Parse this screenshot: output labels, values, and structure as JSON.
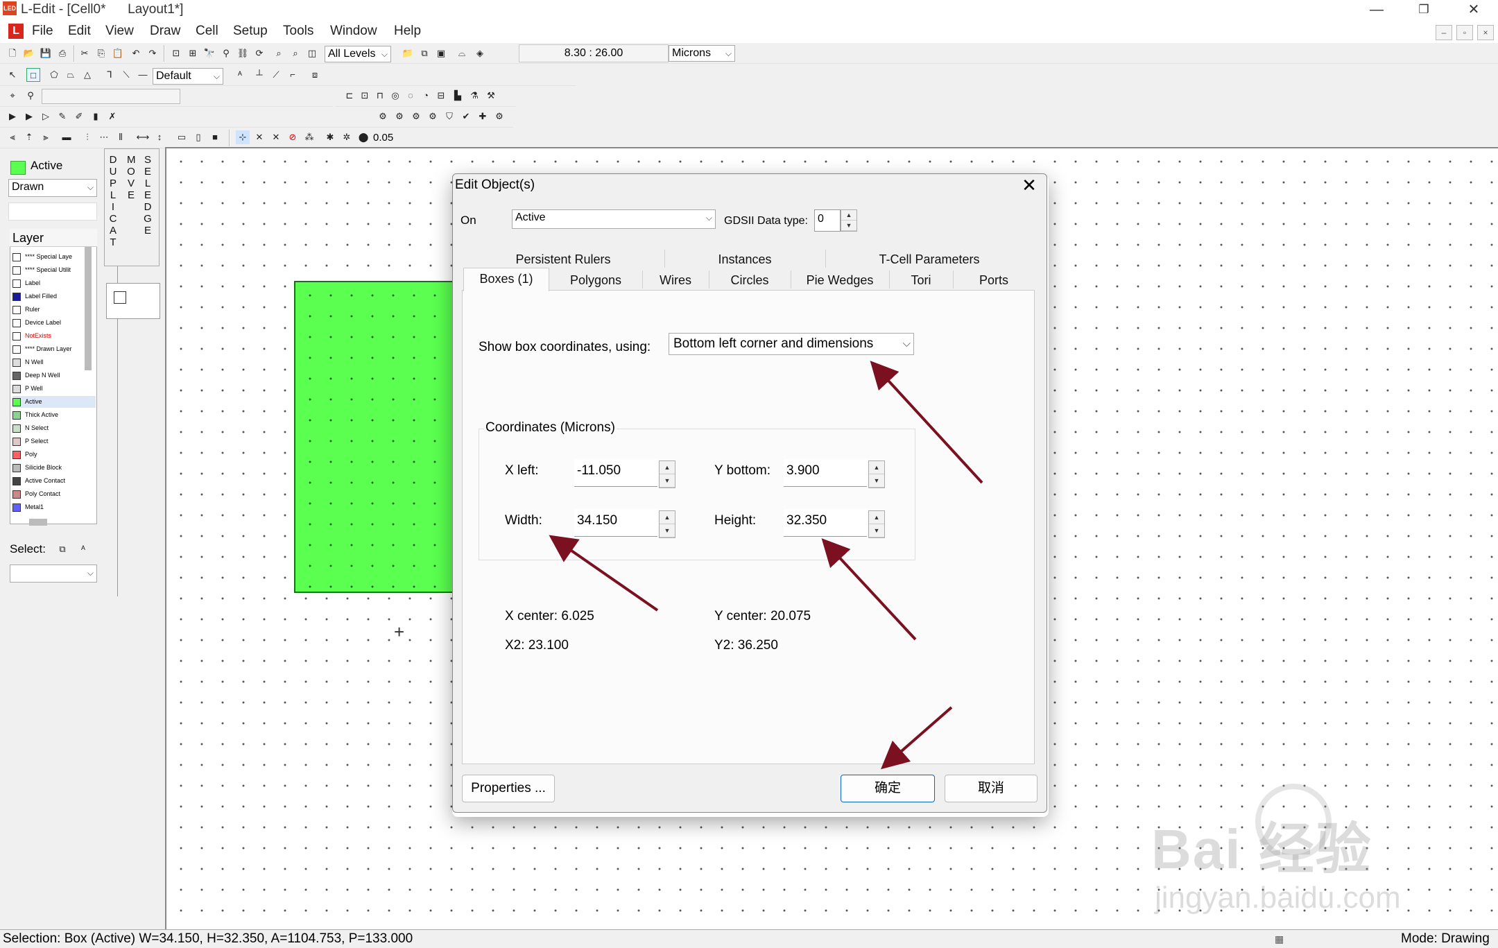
{
  "window": {
    "title": "L-Edit - [Cell0*      Layout1*]",
    "title_icon": "LED",
    "app_logo": "L",
    "minimize": "—",
    "restore": "❐",
    "close": "✕"
  },
  "menu": {
    "items": [
      "File",
      "Edit",
      "View",
      "Draw",
      "Cell",
      "Setup",
      "Tools",
      "Window",
      "Help"
    ],
    "mdi_min": "–",
    "mdi_restore": "▫",
    "mdi_close": "×"
  },
  "toolbar": {
    "levels": "All Levels",
    "coords": "8.30 : 26.00",
    "units": "Microns",
    "style": "Default",
    "snap_value": "0.05"
  },
  "left_panel": {
    "active_label": "Active",
    "active_color": "#5aff4f",
    "drawn": "Drawn",
    "layer_header": "Layer",
    "layers": [
      {
        "name": "**** Special Laye",
        "color": "#ffffff"
      },
      {
        "name": "**** Special Utilit",
        "color": "#ffffff"
      },
      {
        "name": "Label",
        "color": "#ffffff"
      },
      {
        "name": "Label Filled",
        "color": "#1a1aa0"
      },
      {
        "name": "Ruler",
        "color": "#ffffff"
      },
      {
        "name": "Device Label",
        "color": "#ffffff"
      },
      {
        "name": "NotExists",
        "color": "#ffffff",
        "text_color": "#e00000"
      },
      {
        "name": "**** Drawn Layer",
        "color": "#ffffff"
      },
      {
        "name": "N Well",
        "color": "#dddddd"
      },
      {
        "name": "Deep N Well",
        "color": "#666666"
      },
      {
        "name": "P Well",
        "color": "#dddddd"
      },
      {
        "name": "Active",
        "color": "#5aff4f"
      },
      {
        "name": "Thick Active",
        "color": "#8fd18f"
      },
      {
        "name": "N Select",
        "color": "#c8e0c8"
      },
      {
        "name": "P Select",
        "color": "#e0c8c8"
      },
      {
        "name": "Poly",
        "color": "#ff6060"
      },
      {
        "name": "Silicide Block",
        "color": "#bbbbbb"
      },
      {
        "name": "Active Contact",
        "color": "#444444"
      },
      {
        "name": "Poly Contact",
        "color": "#cc8888"
      },
      {
        "name": "Metal1",
        "color": "#6060ff"
      }
    ],
    "select_label": "Select:",
    "modes": [
      "DUPLICAT",
      "MOVE",
      "SEL EDGE"
    ]
  },
  "dialog": {
    "title": "Edit Object(s)",
    "close": "✕",
    "on_label": "On",
    "on_value": "Active",
    "gds_label": "GDSII Data type:",
    "gds_value": "0",
    "tabs_row1": [
      "Persistent Rulers",
      "Instances",
      "T-Cell Parameters"
    ],
    "tabs_row2": [
      "Boxes (1)",
      "Polygons",
      "Wires",
      "Circles",
      "Pie Wedges",
      "Tori",
      "Ports"
    ],
    "show_label": "Show box coordinates, using:",
    "show_value": "Bottom left corner and dimensions",
    "coords_title": "Coordinates (Microns)",
    "x_left_label": "X left:",
    "x_left": "-11.050",
    "y_bottom_label": "Y bottom:",
    "y_bottom": "3.900",
    "width_label": "Width:",
    "width": "34.150",
    "height_label": "Height:",
    "height": "32.350",
    "x_center": "X center: 6.025",
    "y_center": "Y center: 20.075",
    "x2": "X2: 23.100",
    "y2": "Y2: 36.250",
    "properties_btn": "Properties ...",
    "ok_btn": "确定",
    "cancel_btn": "取消"
  },
  "status": {
    "left": "Selection: Box (Active) W=34.150, H=32.350, A=1104.753, P=133.000",
    "right": "Mode: Drawing"
  },
  "watermark": {
    "main": "Bai 经验",
    "sub": "jingyan.baidu.com"
  },
  "colors": {
    "box_fill": "#5aff4f",
    "arrow": "#7a1020",
    "ok_border": "#0a64c8"
  }
}
